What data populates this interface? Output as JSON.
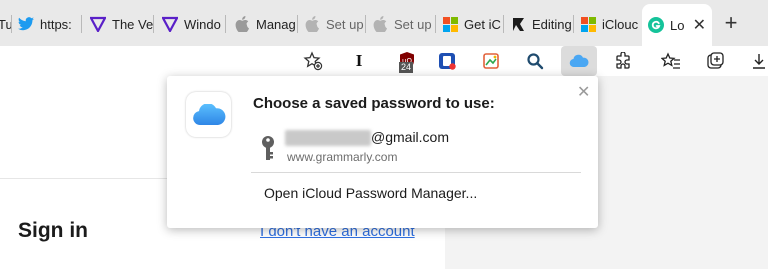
{
  "tabs": [
    {
      "label": "Tu",
      "icon": "generic-icon"
    },
    {
      "label": "https:",
      "icon": "twitter-icon"
    },
    {
      "label": "The Ve",
      "icon": "verge-icon"
    },
    {
      "label": "Windo",
      "icon": "verge-icon"
    },
    {
      "label": "Manag",
      "icon": "apple-icon"
    },
    {
      "label": "Set up",
      "icon": "apple-icon"
    },
    {
      "label": "Set up",
      "icon": "apple-icon"
    },
    {
      "label": "Get iC",
      "icon": "microsoft-icon"
    },
    {
      "label": "Editing",
      "icon": "editing-icon"
    },
    {
      "label": "iClouc",
      "icon": "microsoft-icon"
    },
    {
      "label": "Lo",
      "icon": "grammarly-icon",
      "active": true
    }
  ],
  "toolbar": {
    "extension_badge": "24"
  },
  "popup": {
    "title": "Choose a saved password to use:",
    "email_suffix": "@gmail.com",
    "site": "www.grammarly.com",
    "open_manager": "Open iCloud Password Manager..."
  },
  "page": {
    "signin": "Sign in",
    "no_account": "I don't have an account"
  },
  "colors": {
    "link": "#2f6fe0",
    "grammarly_green": "#15c39a",
    "verge_purple": "#5a20c8",
    "twitter_blue": "#1d9bf0"
  }
}
